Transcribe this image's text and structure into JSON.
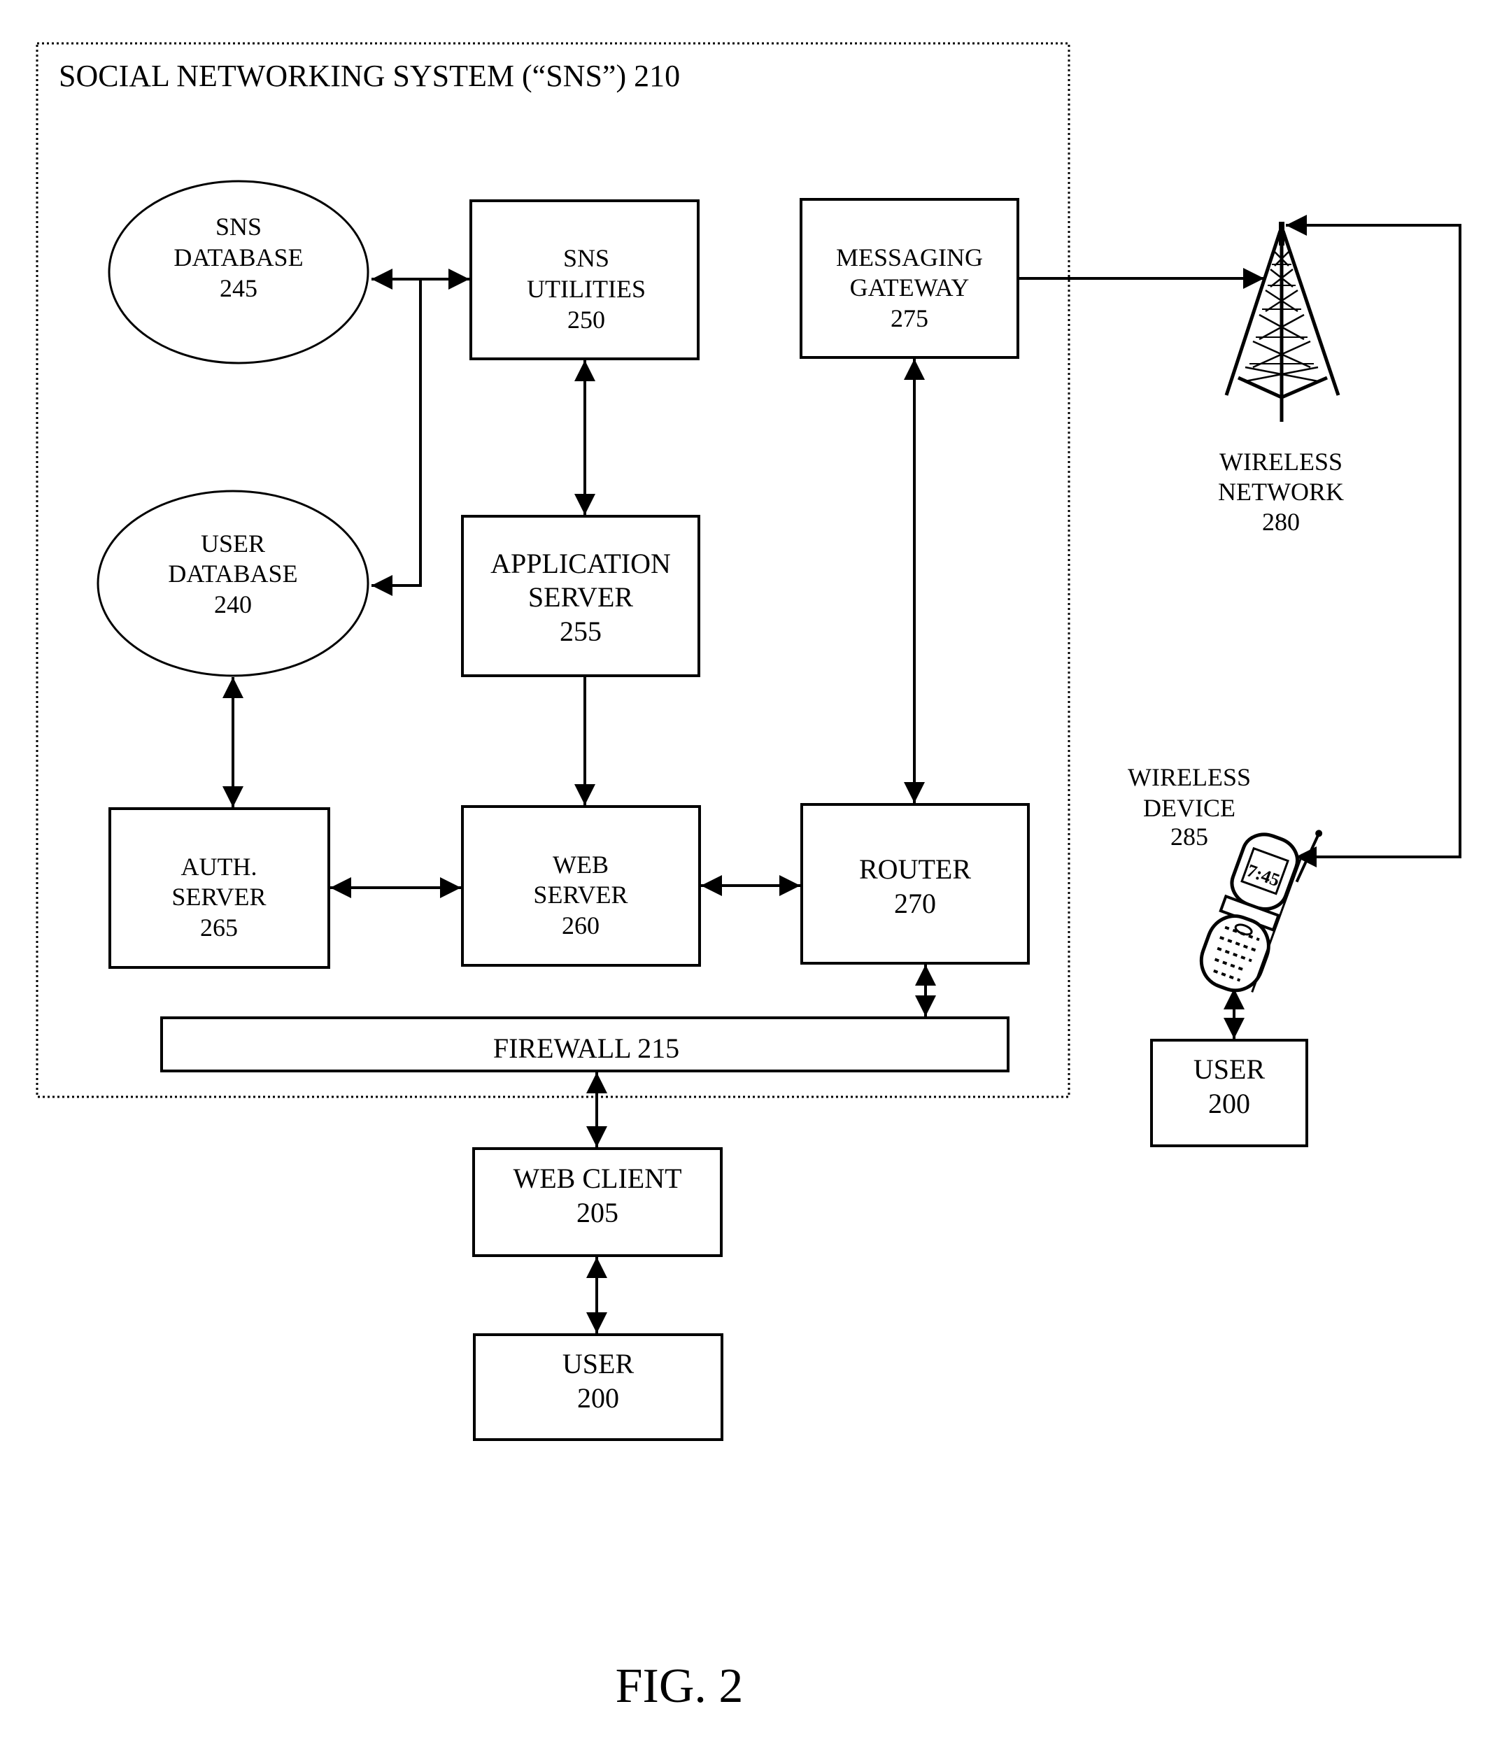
{
  "figure": {
    "caption": "FIG. 2",
    "system_title": "SOCIAL NETWORKING SYSTEM (“SNS”) 210"
  },
  "nodes": {
    "sns_database": {
      "shape": "ellipse",
      "lines": [
        "SNS",
        "DATABASE",
        "245"
      ]
    },
    "sns_utilities": {
      "shape": "box",
      "lines": [
        "SNS",
        "UTILITIES",
        "250"
      ]
    },
    "messaging_gateway": {
      "shape": "box",
      "lines": [
        "MESSAGING",
        "GATEWAY",
        "275"
      ]
    },
    "user_database": {
      "shape": "ellipse",
      "lines": [
        "USER",
        "DATABASE",
        "240"
      ]
    },
    "application_server": {
      "shape": "box",
      "lines": [
        "APPLICATION",
        "SERVER",
        "255"
      ]
    },
    "auth_server": {
      "shape": "box",
      "lines": [
        "AUTH.",
        "SERVER",
        "265"
      ]
    },
    "web_server": {
      "shape": "box",
      "lines": [
        "WEB",
        "SERVER",
        "260"
      ]
    },
    "router": {
      "shape": "box",
      "lines": [
        "ROUTER",
        "270"
      ]
    },
    "firewall": {
      "shape": "box",
      "lines": [
        "FIREWALL 215"
      ]
    },
    "web_client": {
      "shape": "box",
      "lines": [
        "WEB CLIENT",
        "205"
      ]
    },
    "user_web": {
      "shape": "box",
      "lines": [
        "USER",
        "200"
      ]
    },
    "user_wireless": {
      "shape": "box",
      "lines": [
        "USER",
        "200"
      ]
    },
    "wireless_network": {
      "shape": "tower-icon",
      "lines": [
        "WIRELESS",
        "NETWORK",
        "280"
      ]
    },
    "wireless_device": {
      "shape": "phone-icon",
      "lines": [
        "WIRELESS",
        "DEVICE",
        "285"
      ]
    }
  },
  "edges": [
    {
      "from": "sns_database",
      "to": "sns_utilities",
      "direction": "both"
    },
    {
      "from": "user_database",
      "to": "sns_utilities",
      "direction": "both"
    },
    {
      "from": "sns_utilities",
      "to": "application_server",
      "direction": "both"
    },
    {
      "from": "application_server",
      "to": "web_server",
      "direction": "forward"
    },
    {
      "from": "messaging_gateway",
      "to": "router",
      "direction": "both"
    },
    {
      "from": "user_database",
      "to": "auth_server",
      "direction": "both"
    },
    {
      "from": "auth_server",
      "to": "web_server",
      "direction": "both"
    },
    {
      "from": "web_server",
      "to": "router",
      "direction": "both"
    },
    {
      "from": "router",
      "to": "firewall",
      "direction": "both"
    },
    {
      "from": "firewall",
      "to": "web_client",
      "direction": "both"
    },
    {
      "from": "web_client",
      "to": "user_web",
      "direction": "both"
    },
    {
      "from": "messaging_gateway",
      "to": "wireless_network",
      "direction": "forward"
    },
    {
      "from": "wireless_device",
      "to": "wireless_network",
      "direction": "both"
    },
    {
      "from": "wireless_device",
      "to": "user_wireless",
      "direction": "both"
    }
  ]
}
